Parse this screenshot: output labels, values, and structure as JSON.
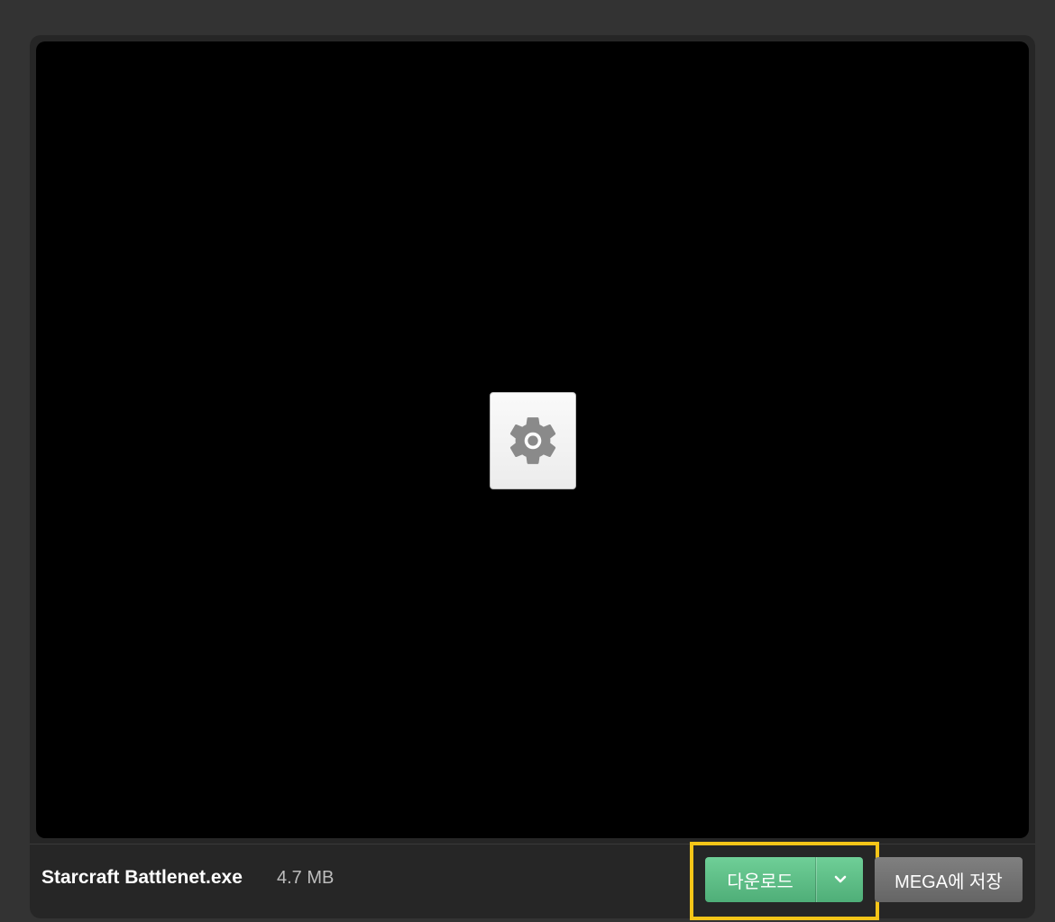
{
  "preview": {
    "icon": "settings-gear-icon"
  },
  "file": {
    "name": "Starcraft Battlenet.exe",
    "size": "4.7 MB"
  },
  "actions": {
    "download_label": "다운로드",
    "download_options_icon": "chevron-down-icon",
    "save_label": "MEGA에 저장"
  },
  "colors": {
    "download_button": "#5bbd86",
    "save_button": "#737373",
    "highlight": "#f5c518",
    "background": "#333333"
  }
}
